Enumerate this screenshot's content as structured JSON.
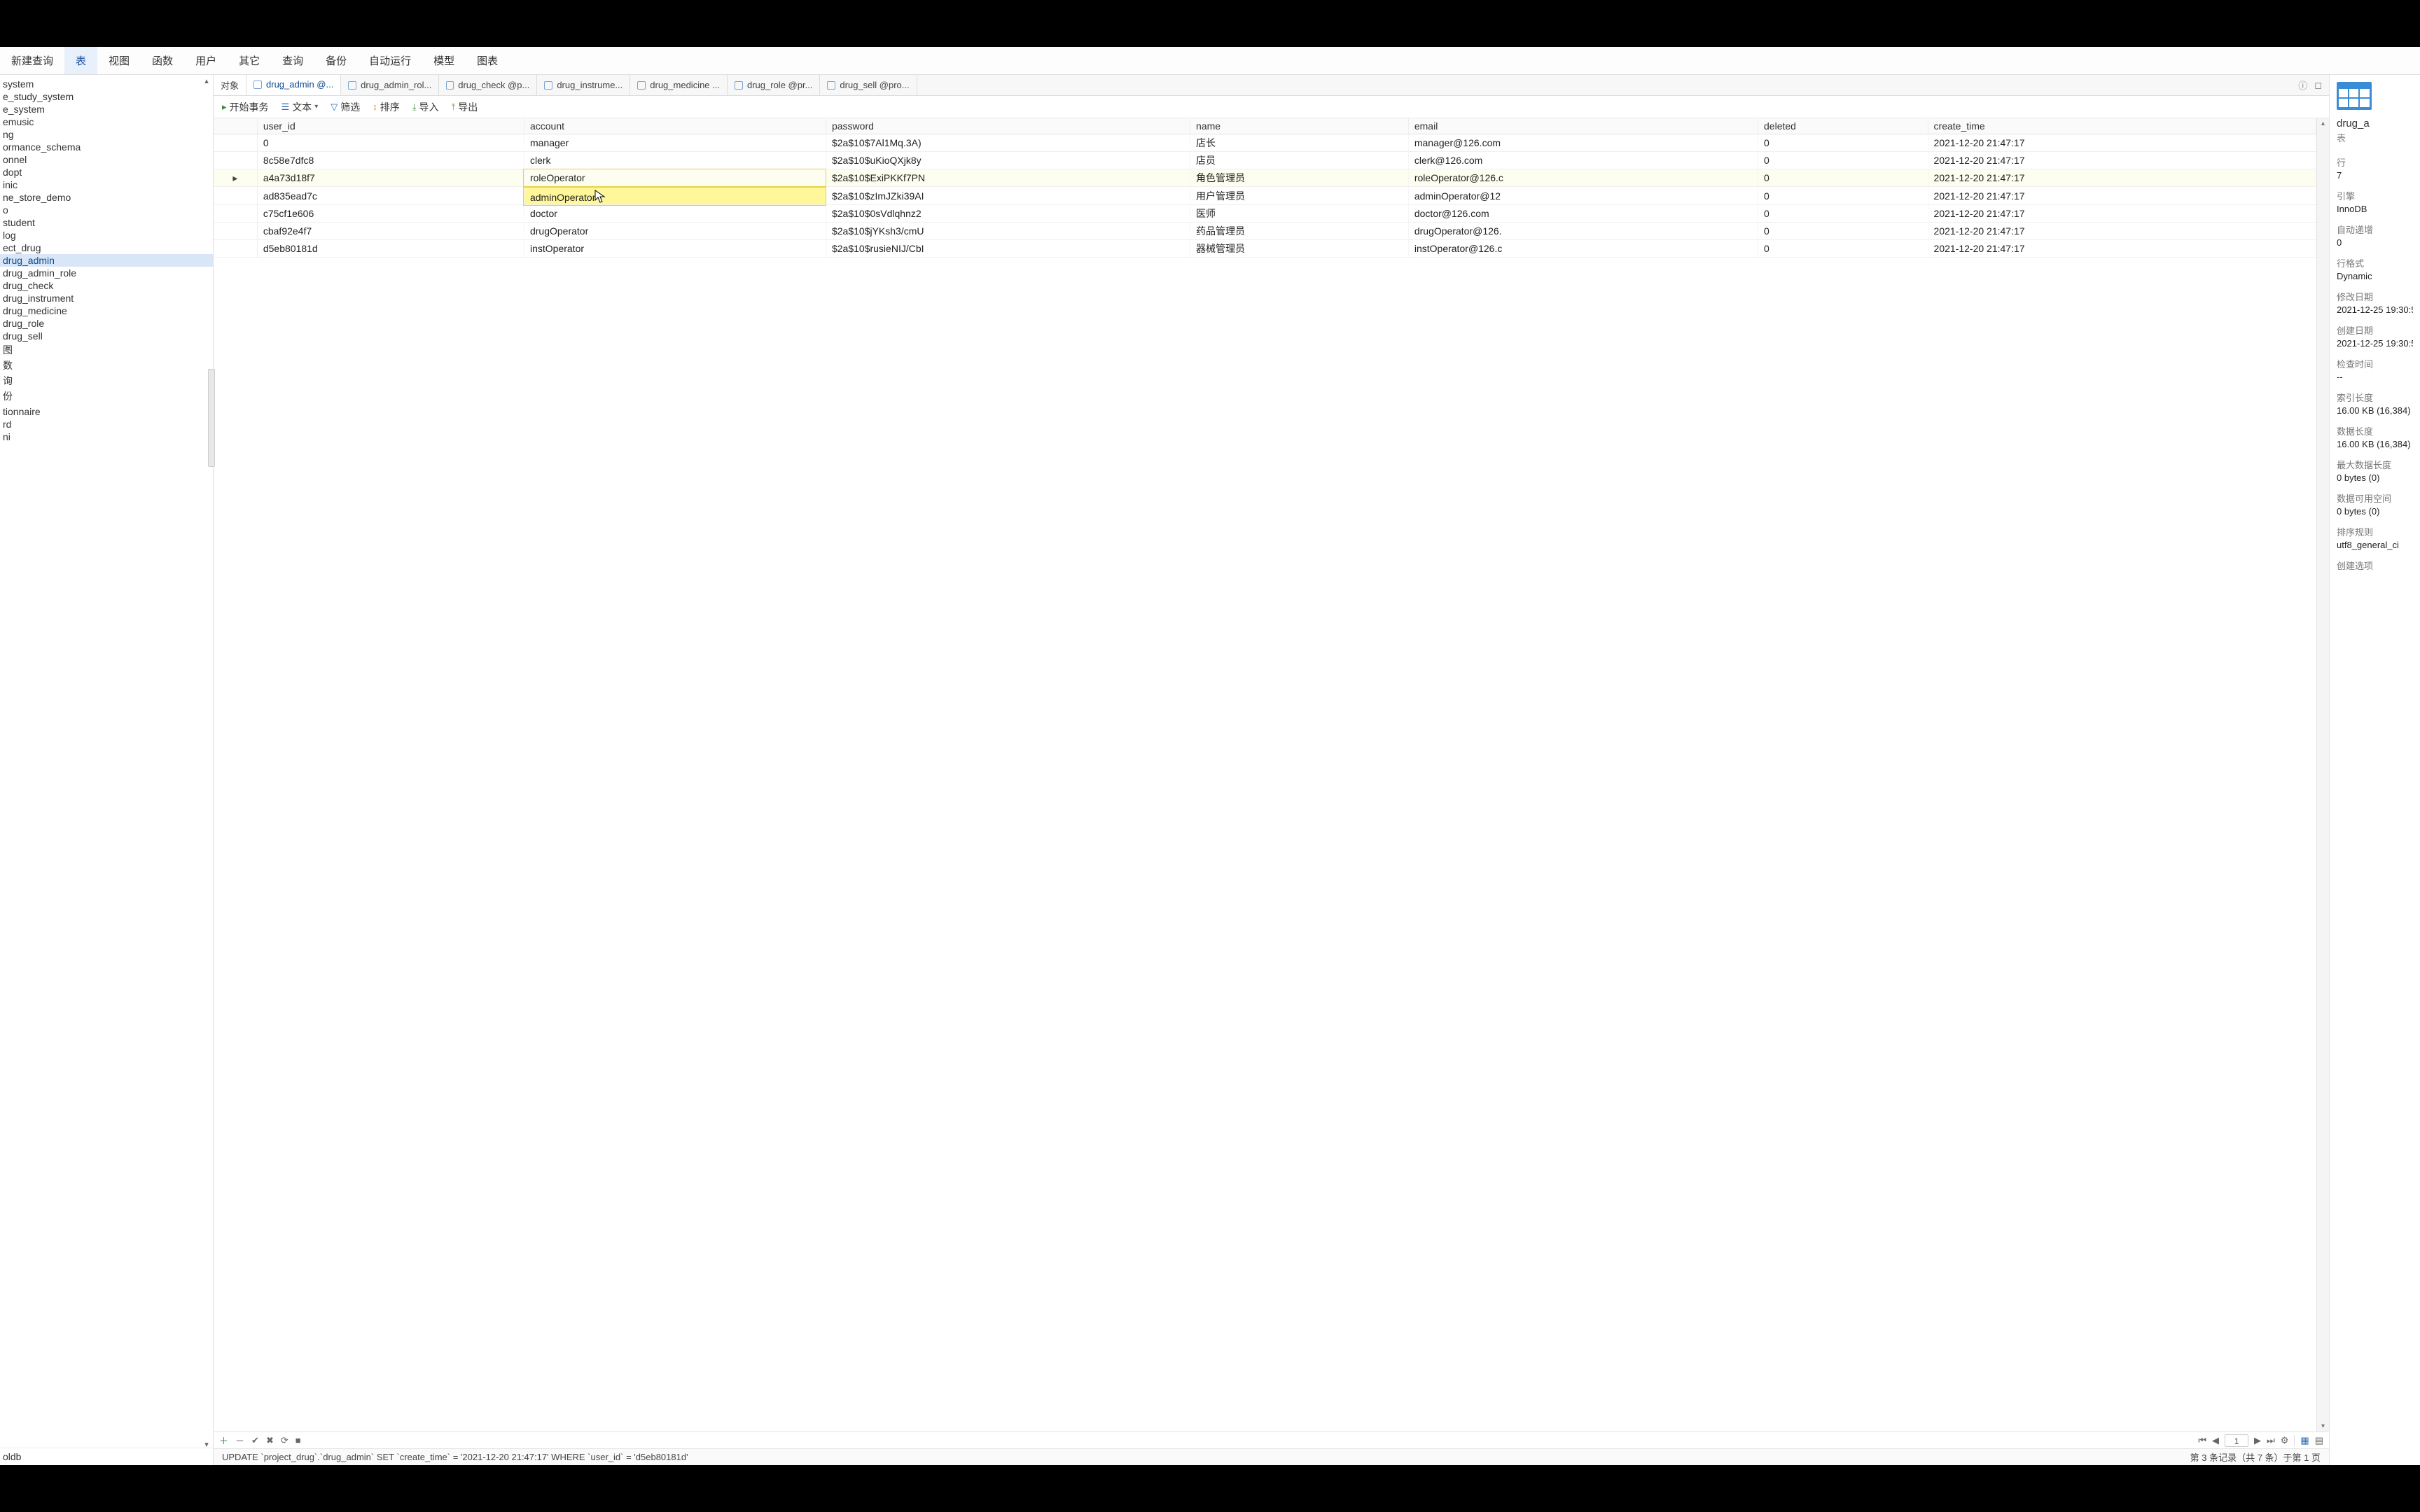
{
  "topnav": {
    "items": [
      "新建查询",
      "表",
      "视图",
      "函数",
      "用户",
      "其它",
      "查询",
      "备份",
      "自动运行",
      "模型",
      "图表"
    ],
    "active_index": 1
  },
  "sidebar": {
    "items": [
      "system",
      "e_study_system",
      "e_system",
      "emusic",
      "ng",
      "ormance_schema",
      "onnel",
      "dopt",
      "inic",
      "ne_store_demo",
      "o",
      "student",
      "log",
      "ect_drug",
      "drug_admin",
      "drug_admin_role",
      "drug_check",
      "drug_instrument",
      "drug_medicine",
      "drug_role",
      "drug_sell",
      "图",
      "数",
      "询",
      "份",
      "",
      "tionnaire",
      "rd",
      "ni"
    ],
    "selected_index": 14,
    "bottom_item": "oldb"
  },
  "tabs": {
    "items": [
      "对象",
      "drug_admin @...",
      "drug_admin_rol...",
      "drug_check @p...",
      "drug_instrume...",
      "drug_medicine ...",
      "drug_role @pr...",
      "drug_sell @pro..."
    ],
    "active_index": 1
  },
  "toolbar2": {
    "begin_tx": "开始事务",
    "text": "文本",
    "filter": "筛选",
    "sort": "排序",
    "import": "导入",
    "export": "导出"
  },
  "grid": {
    "columns": [
      "user_id",
      "account",
      "password",
      "name",
      "email",
      "deleted",
      "create_time"
    ],
    "rows": [
      {
        "user_id": "0",
        "account": "manager",
        "password": "$2a$10$7Al1Mq.3A)",
        "name": "店长",
        "email": "manager@126.com",
        "deleted": "0",
        "create_time": "2021-12-20 21:47:17"
      },
      {
        "user_id": "8c58e7dfc8",
        "account": "clerk",
        "password": "$2a$10$uKioQXjk8y",
        "name": "店员",
        "email": "clerk@126.com",
        "deleted": "0",
        "create_time": "2021-12-20 21:47:17"
      },
      {
        "user_id": "a4a73d18f7",
        "account": "roleOperator",
        "password": "$2a$10$ExiPKKf7PN",
        "name": "角色管理员",
        "email": "roleOperator@126.c",
        "deleted": "0",
        "create_time": "2021-12-20 21:47:17"
      },
      {
        "user_id": "ad835ead7c",
        "account": "adminOperator",
        "password": "$2a$10$zImJZki39AI",
        "name": "用户管理员",
        "email": "adminOperator@12",
        "deleted": "0",
        "create_time": "2021-12-20 21:47:17"
      },
      {
        "user_id": "c75cf1e606",
        "account": "doctor",
        "password": "$2a$10$0sVdlqhnz2",
        "name": "医师",
        "email": "doctor@126.com",
        "deleted": "0",
        "create_time": "2021-12-20 21:47:17"
      },
      {
        "user_id": "cbaf92e4f7",
        "account": "drugOperator",
        "password": "$2a$10$jYKsh3/cmU",
        "name": "药品管理员",
        "email": "drugOperator@126.",
        "deleted": "0",
        "create_time": "2021-12-20 21:47:17"
      },
      {
        "user_id": "d5eb80181d",
        "account": "instOperator",
        "password": "$2a$10$rusieNIJ/CbI",
        "name": "器械管理员",
        "email": "instOperator@126.c",
        "deleted": "0",
        "create_time": "2021-12-20 21:47:17"
      }
    ],
    "active_row_index": 2,
    "highlight": {
      "row": 3,
      "col": "account"
    }
  },
  "right_panel": {
    "table_name": "drug_a",
    "table_sub": "表",
    "props": [
      {
        "label": "行",
        "value": "7"
      },
      {
        "label": "引擎",
        "value": "InnoDB"
      },
      {
        "label": "自动递增",
        "value": "0"
      },
      {
        "label": "行格式",
        "value": "Dynamic"
      },
      {
        "label": "修改日期",
        "value": "2021-12-25 19:30:5"
      },
      {
        "label": "创建日期",
        "value": "2021-12-25 19:30:5"
      },
      {
        "label": "检查时间",
        "value": "--"
      },
      {
        "label": "索引长度",
        "value": "16.00 KB (16,384)"
      },
      {
        "label": "数据长度",
        "value": "16.00 KB (16,384)"
      },
      {
        "label": "最大数据长度",
        "value": "0 bytes (0)"
      },
      {
        "label": "数据可用空间",
        "value": "0 bytes (0)"
      },
      {
        "label": "排序规则",
        "value": "utf8_general_ci"
      },
      {
        "label": "创建选项",
        "value": ""
      }
    ]
  },
  "bottombar": {
    "page": "1"
  },
  "statusbar": {
    "sql": "UPDATE `project_drug`.`drug_admin` SET `create_time` = '2021-12-20 21:47:17' WHERE `user_id` = 'd5eb80181d'",
    "right": "第 3 条记录（共 7 条）于第 1 页"
  }
}
